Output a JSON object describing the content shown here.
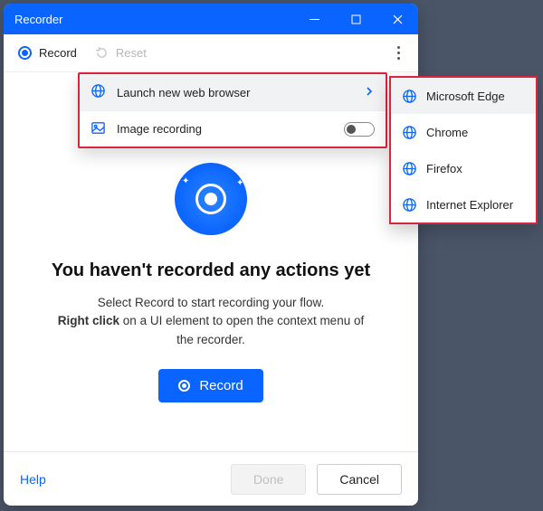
{
  "window": {
    "title": "Recorder"
  },
  "toolbar": {
    "record_label": "Record",
    "reset_label": "Reset"
  },
  "menu": {
    "launch_browser": "Launch new web browser",
    "image_recording": "Image recording"
  },
  "browsers": {
    "items": [
      {
        "label": "Microsoft Edge"
      },
      {
        "label": "Chrome"
      },
      {
        "label": "Firefox"
      },
      {
        "label": "Internet Explorer"
      }
    ]
  },
  "empty": {
    "headline": "You haven't recorded any actions yet",
    "line1": "Select Record to start recording your flow.",
    "bold": "Right click",
    "line2_rest": " on a UI element to open the context menu of the recorder.",
    "record_button": "Record"
  },
  "footer": {
    "help": "Help",
    "done": "Done",
    "cancel": "Cancel"
  }
}
